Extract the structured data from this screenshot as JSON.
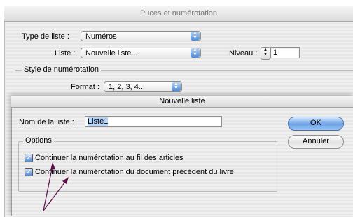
{
  "back_window": {
    "title": "Puces et numérotation",
    "type_label": "Type de liste :",
    "type_value": "Numéros",
    "list_label": "Liste :",
    "list_value": "Nouvelle liste...",
    "level_label": "Niveau :",
    "level_value": "1",
    "style_group_label": "Style de numérotation",
    "format_label": "Format :",
    "format_value": "1, 2, 3, 4..."
  },
  "sheet": {
    "title": "Nouvelle liste",
    "name_label": "Nom de la liste :",
    "name_value": "Liste1",
    "ok_label": "OK",
    "cancel_label": "Annuler",
    "options_label": "Options",
    "checkbox1_label": "Continuer la numérotation au fil des articles",
    "checkbox1_checked": true,
    "checkbox2_label": "Continuer la numérotation du document précédent du livre",
    "checkbox2_checked": true
  },
  "colors": {
    "accent": "#4a87d6",
    "annotation_arrow": "#5a0e4a"
  }
}
